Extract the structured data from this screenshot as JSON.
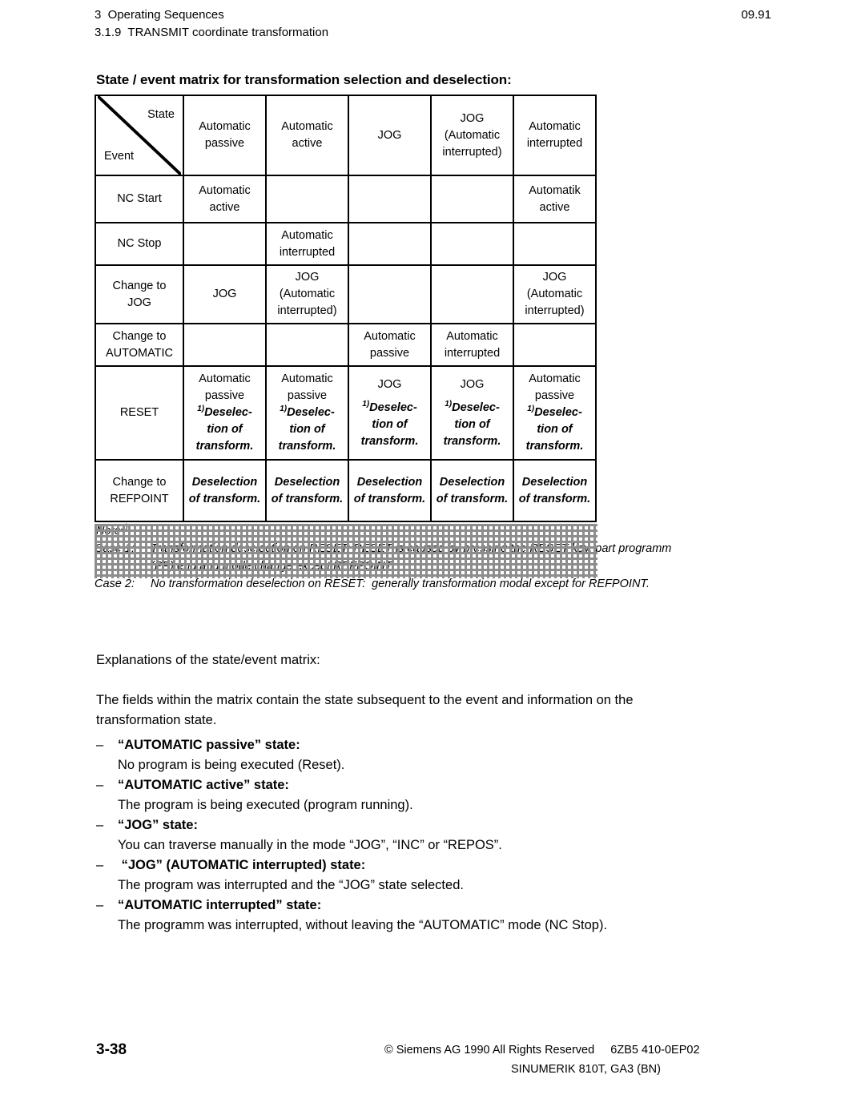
{
  "header": {
    "chapter": "3  Operating Sequences",
    "section": "3.1.9  TRANSMIT coordinate transformation",
    "date": "09.91"
  },
  "matrix": {
    "title": "State / event matrix for transformation selection and deselection:",
    "corner": {
      "state_label": "State",
      "event_label": "Event"
    },
    "columns": [
      {
        "l1": "Automatic",
        "l2": "passive",
        "l3": ""
      },
      {
        "l1": "Automatic",
        "l2": "active",
        "l3": ""
      },
      {
        "l1": "JOG",
        "l2": "",
        "l3": ""
      },
      {
        "l1": "JOG",
        "l2": "(Automatic",
        "l3": "interrupted)"
      },
      {
        "l1": "Automatic",
        "l2": "interrupted",
        "l3": ""
      }
    ],
    "rows": [
      {
        "label_l1": "NC Start",
        "label_l2": "",
        "cells": [
          {
            "hatched": false,
            "l1": "Automatic",
            "l2": "active",
            "l3": ""
          },
          {
            "hatched": true,
            "l1": "",
            "l2": "",
            "l3": ""
          },
          {
            "hatched": true,
            "l1": "",
            "l2": "",
            "l3": ""
          },
          {
            "hatched": true,
            "l1": "",
            "l2": "",
            "l3": ""
          },
          {
            "hatched": false,
            "l1": "Automatik",
            "l2": "active",
            "l3": ""
          }
        ]
      },
      {
        "label_l1": "NC Stop",
        "label_l2": "",
        "cells": [
          {
            "hatched": true,
            "l1": "",
            "l2": "",
            "l3": ""
          },
          {
            "hatched": false,
            "l1": "Automatic",
            "l2": "interrupted",
            "l3": ""
          },
          {
            "hatched": true,
            "l1": "",
            "l2": "",
            "l3": ""
          },
          {
            "hatched": true,
            "l1": "",
            "l2": "",
            "l3": ""
          },
          {
            "hatched": false,
            "l1": "",
            "l2": "",
            "l3": ""
          }
        ]
      },
      {
        "label_l1": "Change to",
        "label_l2": "JOG",
        "cells": [
          {
            "hatched": false,
            "l1": "JOG",
            "l2": "",
            "l3": ""
          },
          {
            "hatched": false,
            "l1": "JOG",
            "l2": "(Automatic",
            "l3": "interrupted)"
          },
          {
            "hatched": true,
            "l1": "",
            "l2": "",
            "l3": ""
          },
          {
            "hatched": true,
            "l1": "",
            "l2": "",
            "l3": ""
          },
          {
            "hatched": false,
            "l1": "JOG",
            "l2": "(Automatic",
            "l3": "interrupted)"
          }
        ]
      },
      {
        "label_l1": "Change to",
        "label_l2": "AUTOMATIC",
        "cells": [
          {
            "hatched": true,
            "l1": "",
            "l2": "",
            "l3": ""
          },
          {
            "hatched": true,
            "l1": "",
            "l2": "",
            "l3": ""
          },
          {
            "hatched": false,
            "l1": "Automatic",
            "l2": "passive",
            "l3": ""
          },
          {
            "hatched": false,
            "l1": "Automatic",
            "l2": "interrupted",
            "l3": ""
          },
          {
            "hatched": true,
            "l1": "",
            "l2": "",
            "l3": ""
          }
        ]
      },
      {
        "label_l1": "RESET",
        "label_l2": "",
        "cells": [
          {
            "hatched": false,
            "l1": "Automatic",
            "l2": "passive",
            "note_sup": "1)",
            "d1": "Deselec-",
            "d2": "tion of",
            "d3": "transform."
          },
          {
            "hatched": false,
            "l1": "Automatic",
            "l2": "passive",
            "note_sup": "1)",
            "d1": "Deselec-",
            "d2": "tion of",
            "d3": "transform."
          },
          {
            "hatched": false,
            "l1": "JOG",
            "l2": "",
            "note_sup": "1)",
            "d1": "Deselec-",
            "d2": "tion of",
            "d3": "transform."
          },
          {
            "hatched": false,
            "l1": "JOG",
            "l2": "",
            "note_sup": "1)",
            "d1": "Deselec-",
            "d2": "tion of",
            "d3": "transform."
          },
          {
            "hatched": false,
            "l1": "Automatic",
            "l2": "passive",
            "note_sup": "1)",
            "d1": "Deselec-",
            "d2": "tion of",
            "d3": "transform."
          }
        ]
      },
      {
        "label_l1": "Change to",
        "label_l2": "REFPOINT",
        "cells": [
          {
            "hatched": false,
            "d1": "Deselection",
            "d2": "of transform."
          },
          {
            "hatched": false,
            "d1": "Deselection",
            "d2": "of transform."
          },
          {
            "hatched": false,
            "d1": "Deselection",
            "d2": "of transform."
          },
          {
            "hatched": false,
            "d1": "Deselection",
            "d2": "of transform."
          },
          {
            "hatched": false,
            "d1": "Deselection",
            "d2": "of transform."
          }
        ]
      }
    ]
  },
  "notes": {
    "title": "Note",
    "title_sup": "1)",
    "case1_tag": "Case 1:",
    "case1_text": "Transformation deselection on RESET: RESET is caused by pressing the RESET key, part programm",
    "case1_text2": "(PP) end and mode change except REFPOINT.",
    "case2_tag": "Case 2:",
    "case2_text": "No transformation deselection on RESET:  generally transformation modal except for REFPOINT."
  },
  "explanations": {
    "intro": "Explanations of the state/event matrix:",
    "para1_line1": "The fields within the matrix contain the state subsequent to the event and information on the",
    "para1_line2": "transformation state.",
    "items": [
      {
        "dash": "–",
        "term": "“AUTOMATIC passive” state:",
        "desc": "No program is being executed (Reset)."
      },
      {
        "dash": "–",
        "term": "“AUTOMATIC active” state:",
        "desc": "The program is being executed (program running)."
      },
      {
        "dash": "–",
        "term": "“JOG” state:",
        "desc": "You can traverse manually in the mode “JOG”, “INC” or “REPOS”."
      },
      {
        "dash": "–",
        "term": " “JOG” (AUTOMATIC interrupted) state:",
        "desc": "The program was interrupted and the “JOG” state selected."
      },
      {
        "dash": "–",
        "term": "“AUTOMATIC interrupted” state:",
        "desc": "The programm was interrupted, without leaving the “AUTOMATIC” mode (NC Stop)."
      }
    ]
  },
  "footer": {
    "page_number": "3-38",
    "copyright": "© Siemens AG 1990 All Rights Reserved     6ZB5 410-0EP02",
    "product": "SINUMERIK 810T, GA3 (BN)"
  }
}
